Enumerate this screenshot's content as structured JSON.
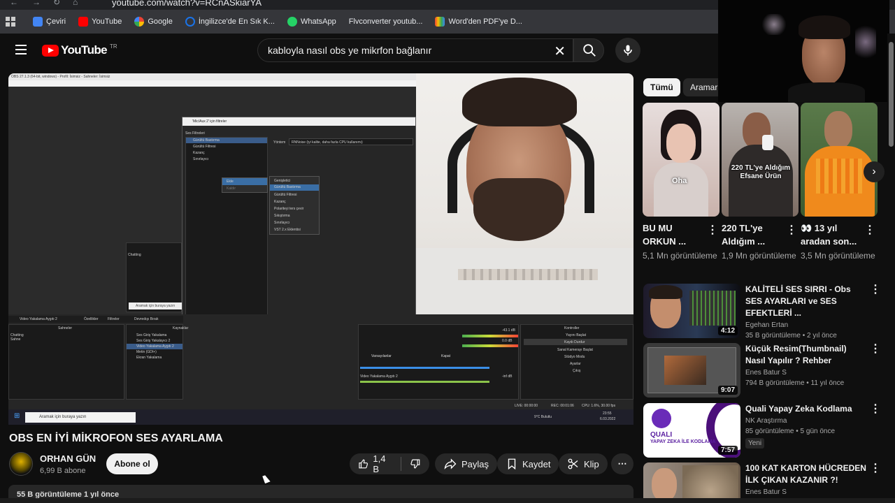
{
  "browser": {
    "url": "youtube.com/watch?v=RCnASkiarYA",
    "bookmarks": [
      {
        "label": "Çeviri",
        "color": "#4285f4"
      },
      {
        "label": "YouTube",
        "color": "#ff0000"
      },
      {
        "label": "Google",
        "color": "#fbbc05"
      },
      {
        "label": "İngilizce'de En Sık K...",
        "color": "#1a73e8"
      },
      {
        "label": "WhatsApp",
        "color": "#25d366"
      },
      {
        "label": "Flvconverter youtub...",
        "color": "#35363a"
      },
      {
        "label": "Word'den PDF'ye D...",
        "color": "#ea4335"
      }
    ]
  },
  "header": {
    "logo": "YouTube",
    "region": "TR",
    "search_query": "kabloyla nasıl obs ye mikrfon bağlanır"
  },
  "player": {
    "obs_window_title": "OBS 27.1.3 (64-bit, windows) - Profil: İsimsiz - Sahneler: İsimsiz",
    "filter_dialog_title": "'Mic/Aux 2' için filtreler",
    "filter_section": "Ses Filtreleri",
    "filters": [
      "Gürültü Bastırma",
      "Gürültü Filtresi",
      "Kazanç",
      "Sınırlayıcı"
    ],
    "method_label": "Yöntem",
    "method_value": "RNNoise (iyi kalite, daha fazla CPU kullanımı)",
    "context_menu": [
      "Ekle",
      "Kaldır"
    ],
    "submenu": [
      "Genişletici",
      "Gürültü Bastırma",
      "Gürültü Filtresi",
      "Kazanç",
      "Polariteyi ters çevir",
      "Sıkıştırma",
      "Sınırlayıcı",
      "VST 2.x Eklentisi"
    ],
    "scenes_header": "Sahneler",
    "scenes": [
      "Chatting",
      "Sahne"
    ],
    "sources_header": "Kaynaklar",
    "sources": [
      "Ses Giriş Yakalama",
      "Ses Giriş Yakalayıcı 2",
      "Video Yakalama Aygıtı 2",
      "Metin (GDI+)",
      "Ekran Yakalama"
    ],
    "source_bar": "Video Yakalama Aygıtı 2",
    "source_props": "Özellikler",
    "source_filters": "Filtreler",
    "deactivate": "Devredışı Bırak",
    "controls_header": "Kontroller",
    "controls": [
      "Yayını Başlat",
      "Kaydı Durdur",
      "Sanal Kamerayı Başlat",
      "Stüdyo Modu",
      "Ayarlar",
      "Çıkış"
    ],
    "mixer_item": "Video Yakalama Aygıtı 2",
    "mixer_db": [
      "-43.1 dB",
      "0.0 dB",
      "-inf dB"
    ],
    "defaults_btn": "Varsayılanlar",
    "close_btn": "Kapat",
    "status_live": "LIVE: 00:00:00",
    "status_rec": "REC: 00:01:06",
    "status_cpu": "CPU: 1.6%, 30.00 fps",
    "win_search": "Aramak için buraya yazın",
    "weather": "9°C Bulutlu",
    "clock_time": "23:55",
    "clock_date": "6.03.2022"
  },
  "video": {
    "title": "OBS EN İYİ MİKROFON SES AYARLAMA",
    "channel": "ORHAN GÜN",
    "subscribers": "6,99 B abone",
    "subscribe_label": "Abone ol",
    "likes": "1,4 B",
    "share_label": "Paylaş",
    "save_label": "Kaydet",
    "clip_label": "Klip"
  },
  "sidebar": {
    "chips": [
      "Tümü",
      "Aramar"
    ],
    "shorts": [
      {
        "title": "BU MU ORKUN ...",
        "views": "5,1 Mn görüntüleme",
        "caption": "Oha"
      },
      {
        "title": "220 TL'ye Aldığım ...",
        "views": "1,9 Mn görüntüleme",
        "caption": "220 TL'ye Aldığım Efsane Ürün"
      },
      {
        "title": "👀 13 yıl aradan son...",
        "views": "3,5 Mn görüntüleme",
        "caption": ""
      }
    ],
    "videos": [
      {
        "title": "KALİTELİ SES SIRRI - Obs SES AYARLARI ve SES EFEKTLERİ ...",
        "channel": "Egehan Ertan",
        "meta": "35 B görüntüleme • 2 yıl önce",
        "duration": "4:12",
        "badge": ""
      },
      {
        "title": "Küçük Resim(Thumbnail) Nasıl Yapılır ? Rehber",
        "channel": "Enes Batur S",
        "meta": "794 B görüntüleme • 11 yıl önce",
        "duration": "9:07",
        "badge": ""
      },
      {
        "title": "Quali Yapay Zeka Kodlama",
        "channel": "NK Araştırma",
        "meta": "85 görüntüleme • 5 gün önce",
        "duration": "7:57",
        "badge": "Yeni",
        "thumb_text": [
          "QUALI",
          "YAPAY ZEKA İLE KODLAMA"
        ]
      },
      {
        "title": "100 KAT KARTON HÜCREDEN İLK ÇIKAN KAZANIR ?!",
        "channel": "Enes Batur S",
        "meta": "",
        "duration": "",
        "badge": ""
      }
    ]
  },
  "desc_partial": "55 B görüntüleme  1 yıl önce"
}
